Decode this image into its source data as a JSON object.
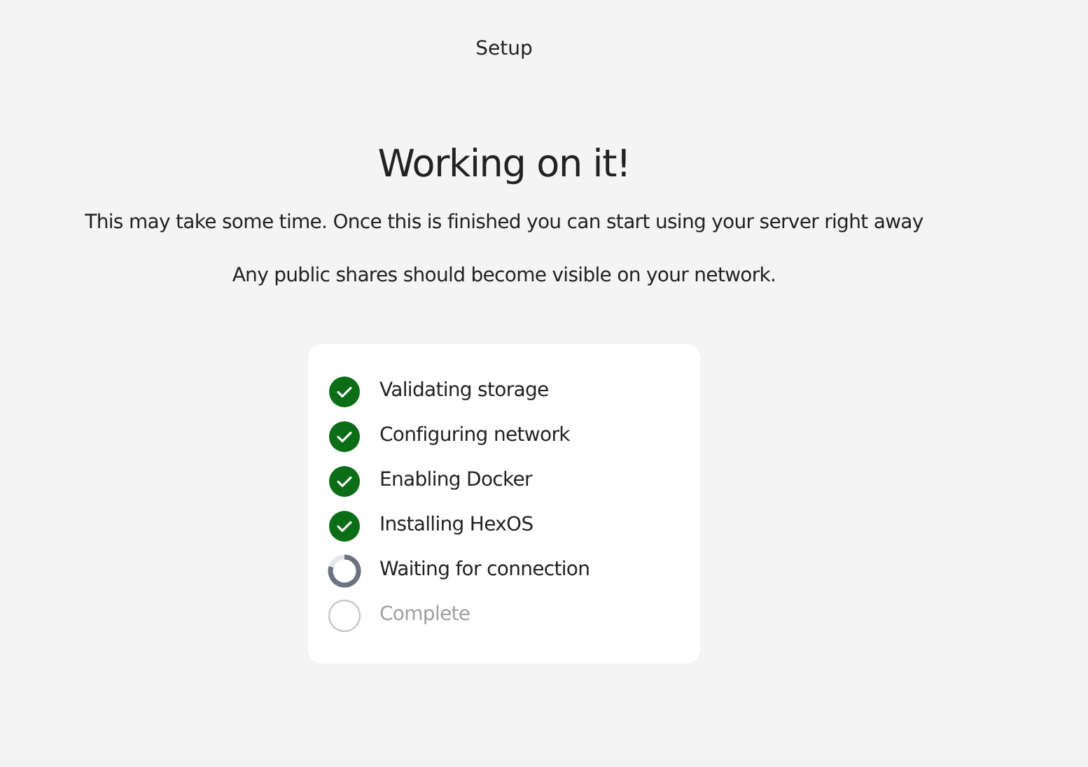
{
  "header": {
    "title": "Setup"
  },
  "heading": "Working on it!",
  "messages": [
    "This may take some time. Once this is finished you can start using your server right away",
    "Any public shares should become visible on your network."
  ],
  "steps": [
    {
      "label": "Validating storage",
      "kind": "done"
    },
    {
      "label": "Configuring network",
      "kind": "done"
    },
    {
      "label": "Enabling Docker",
      "kind": "done"
    },
    {
      "label": "Installing HexOS",
      "kind": "done"
    },
    {
      "label": "Waiting for connection",
      "kind": "active"
    },
    {
      "label": "Complete",
      "kind": "pending"
    }
  ]
}
